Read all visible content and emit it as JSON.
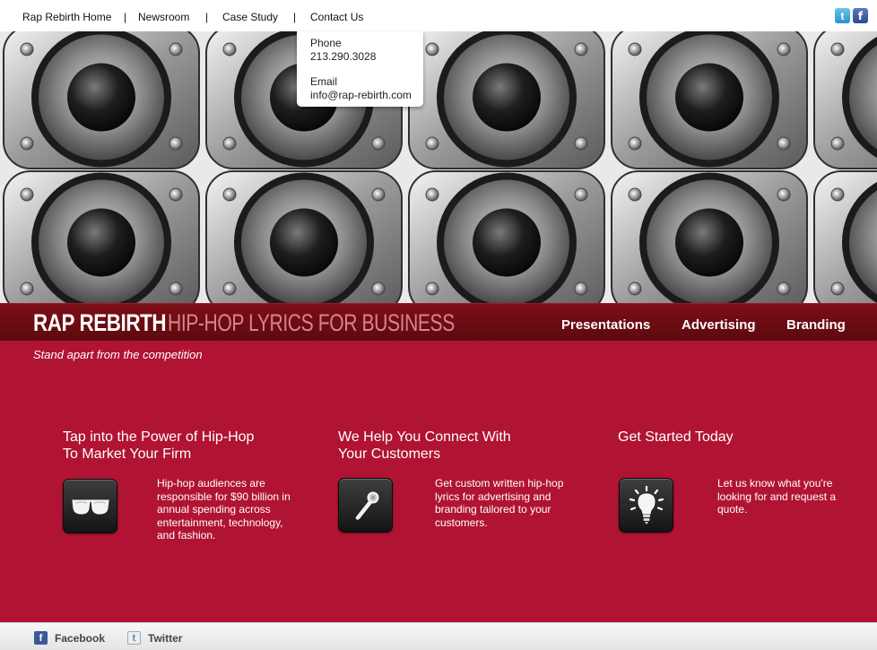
{
  "topnav": {
    "items": [
      "Rap Rebirth Home",
      "Newsroom",
      "Case Study",
      "Contact Us"
    ],
    "separator": "|"
  },
  "social_top": {
    "twitter_icon": "t",
    "facebook_icon": "f"
  },
  "contact_dropdown": {
    "phone_label": "Phone",
    "phone_value": "213.290.3028",
    "email_label": "Email",
    "email_value": "info@rap-rebirth.com"
  },
  "brand": {
    "name": "RAP REBIRTH",
    "tagline": "HIP-HOP LYRICS FOR BUSINESS",
    "nav": [
      "Presentations",
      "Advertising",
      "Branding"
    ]
  },
  "main": {
    "subtitle": "Stand apart from the competition",
    "columns": [
      {
        "title_line1": "Tap into the Power of Hip-Hop",
        "title_line2": "To Market Your Firm",
        "icon": "sunglasses-icon",
        "text_lines": [
          "Hip-hop audiences are",
          "responsible for $90 billion in",
          "annual spending across",
          "entertainment, technology,",
          "and fashion."
        ]
      },
      {
        "title_line1": "We Help You Connect With",
        "title_line2": "Your Customers",
        "icon": "microphone-icon",
        "text_lines": [
          "Get custom written hip-hop",
          "lyrics for advertising and",
          "branding tailored to your",
          "customers."
        ]
      },
      {
        "title_line1": "Get Started Today",
        "title_line2": "",
        "icon": "lightbulb-icon",
        "text_lines": [
          "Let us know what you're",
          "looking for and request a",
          "quote."
        ]
      }
    ]
  },
  "footer": {
    "facebook_label": "Facebook",
    "facebook_icon": "f",
    "twitter_label": "Twitter",
    "twitter_icon": "t"
  },
  "colors": {
    "brand_bar": "#6e0c13",
    "main_red": "#b01432",
    "brand_tag": "#d9838b"
  }
}
